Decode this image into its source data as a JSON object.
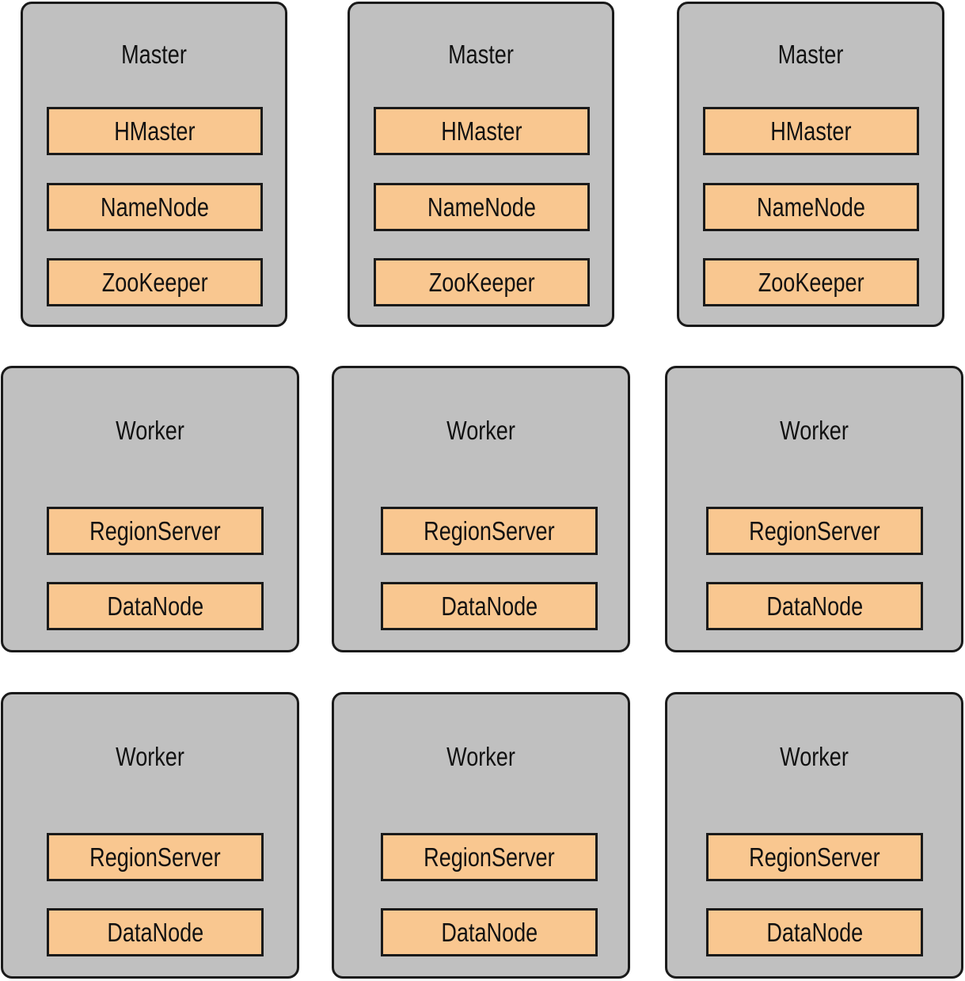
{
  "colors": {
    "node_fill": "#c0c0c0",
    "service_fill": "#f9c790",
    "border": "#1a1a1a"
  },
  "masters": [
    {
      "title": "Master",
      "services": [
        "HMaster",
        "NameNode",
        "ZooKeeper"
      ]
    },
    {
      "title": "Master",
      "services": [
        "HMaster",
        "NameNode",
        "ZooKeeper"
      ]
    },
    {
      "title": "Master",
      "services": [
        "HMaster",
        "NameNode",
        "ZooKeeper"
      ]
    }
  ],
  "workers": [
    {
      "title": "Worker",
      "services": [
        "RegionServer",
        "DataNode"
      ]
    },
    {
      "title": "Worker",
      "services": [
        "RegionServer",
        "DataNode"
      ]
    },
    {
      "title": "Worker",
      "services": [
        "RegionServer",
        "DataNode"
      ]
    },
    {
      "title": "Worker",
      "services": [
        "RegionServer",
        "DataNode"
      ]
    },
    {
      "title": "Worker",
      "services": [
        "RegionServer",
        "DataNode"
      ]
    },
    {
      "title": "Worker",
      "services": [
        "RegionServer",
        "DataNode"
      ]
    }
  ]
}
